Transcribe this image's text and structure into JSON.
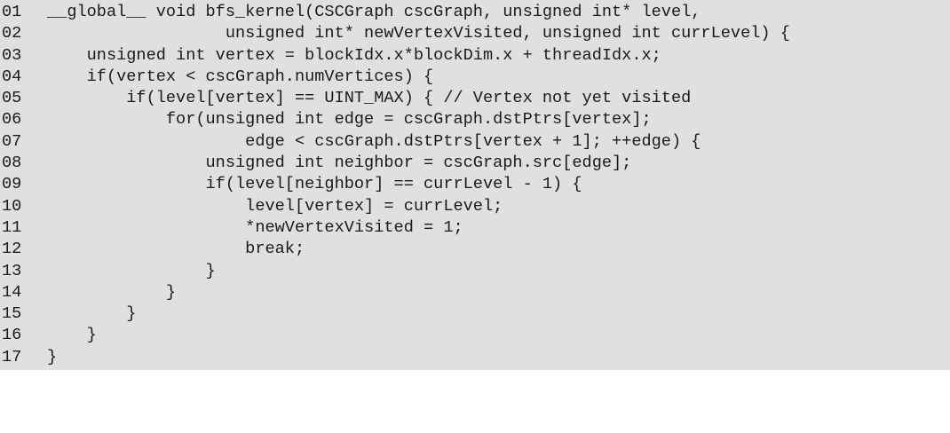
{
  "code": {
    "lines": [
      {
        "number": "01",
        "text": "__global__ void bfs_kernel(CSCGraph cscGraph, unsigned int* level,"
      },
      {
        "number": "02",
        "text": "                  unsigned int* newVertexVisited, unsigned int currLevel) {"
      },
      {
        "number": "03",
        "text": "    unsigned int vertex = blockIdx.x*blockDim.x + threadIdx.x;"
      },
      {
        "number": "04",
        "text": "    if(vertex < cscGraph.numVertices) {"
      },
      {
        "number": "05",
        "text": "        if(level[vertex] == UINT_MAX) { // Vertex not yet visited"
      },
      {
        "number": "06",
        "text": "            for(unsigned int edge = cscGraph.dstPtrs[vertex];"
      },
      {
        "number": "07",
        "text": "                    edge < cscGraph.dstPtrs[vertex + 1]; ++edge) {"
      },
      {
        "number": "08",
        "text": "                unsigned int neighbor = cscGraph.src[edge];"
      },
      {
        "number": "09",
        "text": "                if(level[neighbor] == currLevel - 1) {"
      },
      {
        "number": "10",
        "text": "                    level[vertex] = currLevel;"
      },
      {
        "number": "11",
        "text": "                    *newVertexVisited = 1;"
      },
      {
        "number": "12",
        "text": "                    break;"
      },
      {
        "number": "13",
        "text": "                }"
      },
      {
        "number": "14",
        "text": "            }"
      },
      {
        "number": "15",
        "text": "        }"
      },
      {
        "number": "16",
        "text": "    }"
      },
      {
        "number": "17",
        "text": "}"
      }
    ]
  }
}
